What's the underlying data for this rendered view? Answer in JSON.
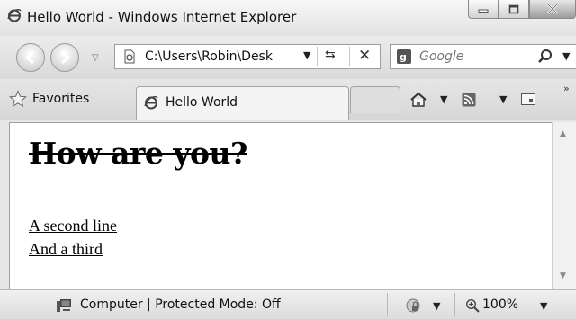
{
  "window": {
    "title": "Hello World - Windows Internet Explorer",
    "buttons": {
      "minimize_icon": "minimize-icon",
      "maximize_icon": "maximize-icon",
      "close_icon": "close-icon"
    }
  },
  "navigation": {
    "address": "C:\\Users\\Robin\\Desk",
    "search_placeholder": "Google"
  },
  "toolbar": {
    "favorites_label": "Favorites",
    "tab_label": "Hello World"
  },
  "page": {
    "heading": "How are you?",
    "lines": [
      "A second line",
      "And a third"
    ]
  },
  "status": {
    "zone_text": "Computer | Protected Mode: Off",
    "zoom": "100%"
  },
  "colors": {
    "chrome": "#e6e6e6",
    "content_bg": "#ffffff"
  }
}
